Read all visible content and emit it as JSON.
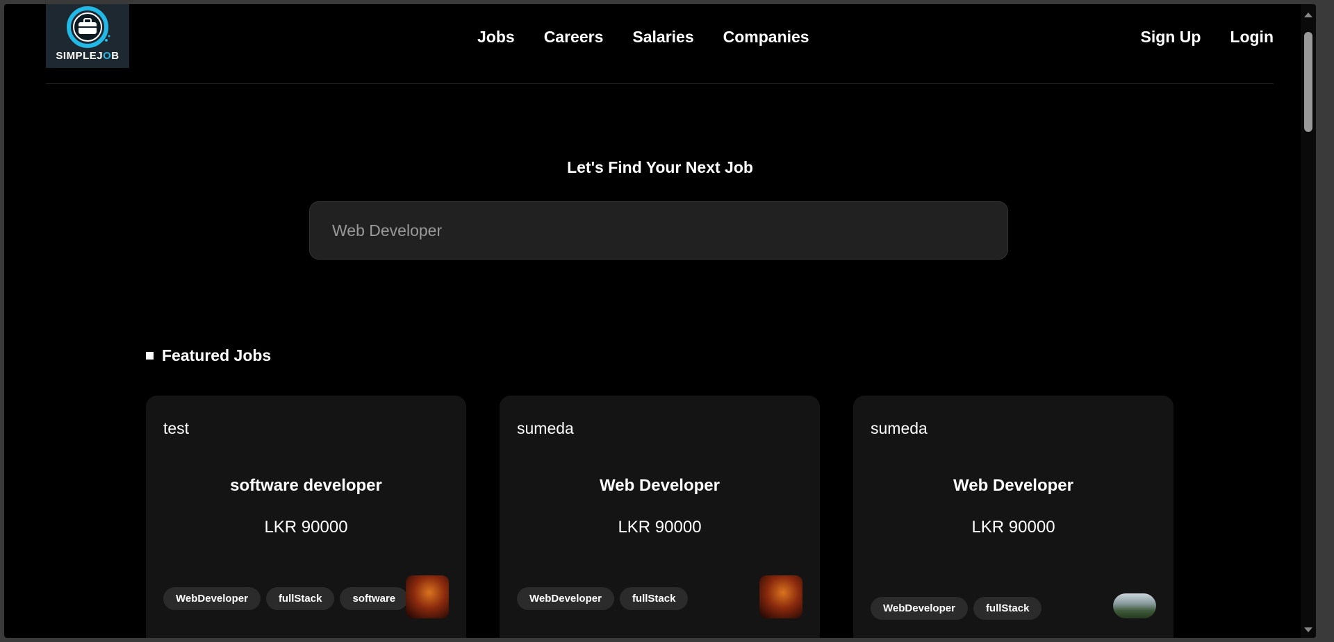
{
  "brand": {
    "name_part1": "SIMPLEJ",
    "name_part2": "O",
    "name_part3": "B",
    "accent_color": "#22b9e6"
  },
  "nav": {
    "links": [
      "Jobs",
      "Careers",
      "Salaries",
      "Companies"
    ],
    "signup": "Sign Up",
    "login": "Login"
  },
  "hero": {
    "title": "Let's Find Your Next Job"
  },
  "search": {
    "placeholder": "Web Developer"
  },
  "featured": {
    "title": "Featured Jobs",
    "cards": [
      {
        "company": "test",
        "title": "software developer",
        "salary": "LKR 90000",
        "tags": [
          "WebDeveloper",
          "fullStack",
          "software"
        ],
        "image": "singer-photo"
      },
      {
        "company": "sumeda",
        "title": "Web Developer",
        "salary": "LKR 90000",
        "tags": [
          "WebDeveloper",
          "fullStack"
        ],
        "image": "singer-photo"
      },
      {
        "company": "sumeda",
        "title": "Web Developer",
        "salary": "LKR 90000",
        "tags": [
          "WebDeveloper",
          "fullStack"
        ],
        "image": "landscape-photo"
      }
    ]
  }
}
